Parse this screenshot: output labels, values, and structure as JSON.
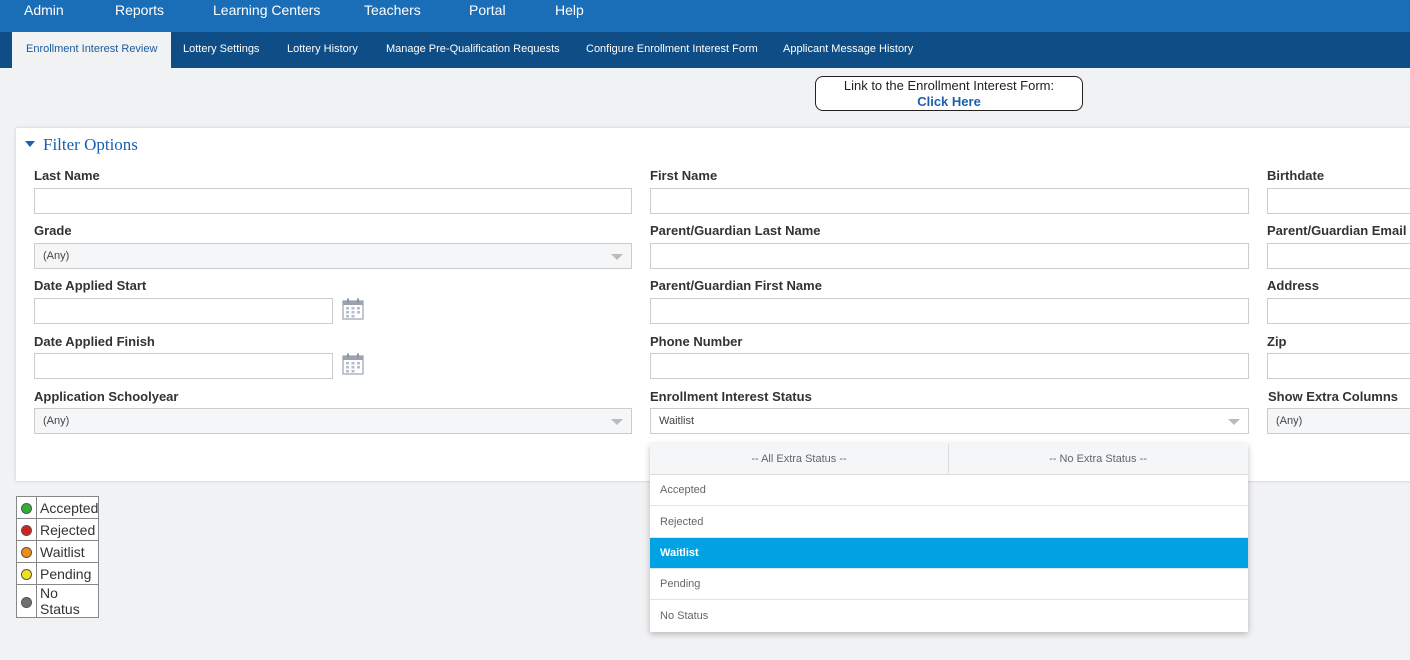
{
  "topnav": {
    "items": [
      "Admin",
      "Reports",
      "Learning Centers",
      "Teachers",
      "Portal",
      "Help"
    ]
  },
  "subnav": {
    "tabs": [
      "Enrollment Interest Review",
      "Lottery Settings",
      "Lottery History",
      "Manage Pre-Qualification Requests",
      "Configure Enrollment Interest Form",
      "Applicant Message History"
    ]
  },
  "linkbox": {
    "text": "Link to the Enrollment Interest Form:",
    "link": "Click Here"
  },
  "filter": {
    "title": "Filter Options",
    "last_name": "Last Name",
    "first_name": "First Name",
    "birthdate": "Birthdate",
    "grade": "Grade",
    "grade_value": "(Any)",
    "pg_last_name": "Parent/Guardian Last Name",
    "pg_email": "Parent/Guardian Email A",
    "date_start": "Date Applied Start",
    "pg_first_name": "Parent/Guardian First Name",
    "address": "Address",
    "date_finish": "Date Applied Finish",
    "phone": "Phone Number",
    "zip": "Zip",
    "schoolyear": "Application Schoolyear",
    "schoolyear_value": "(Any)",
    "status": "Enrollment Interest Status",
    "status_value": "Waitlist",
    "extra_columns": "Show Extra Columns",
    "extra_columns_value": "(Any)"
  },
  "dropdown": {
    "all_extra": "-- All Extra Status --",
    "no_extra": "-- No Extra Status --",
    "options": [
      "Accepted",
      "Rejected",
      "Waitlist",
      "Pending",
      "No Status"
    ],
    "selected": "Waitlist"
  },
  "legend": {
    "items": [
      {
        "label": "Accepted",
        "color": "#33b033"
      },
      {
        "label": "Rejected",
        "color": "#d42020"
      },
      {
        "label": "Waitlist",
        "color": "#f08a18"
      },
      {
        "label": "Pending",
        "color": "#f0e020"
      },
      {
        "label": "No Status",
        "color": "#707070"
      }
    ]
  },
  "colors": {
    "topnav": "#1a6eb8",
    "subnav": "#0e4d85",
    "selected_option": "#00a2e3"
  }
}
